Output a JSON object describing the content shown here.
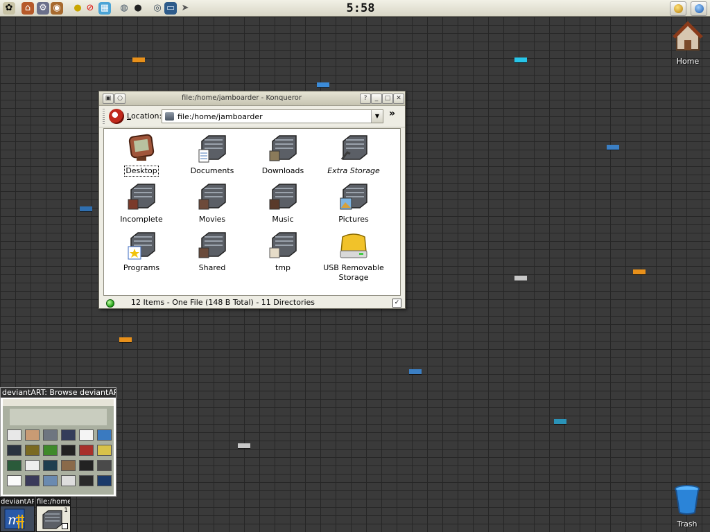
{
  "panel": {
    "clock": "5:58",
    "launchers": [
      "kde-menu-icon",
      "home-folder-icon",
      "settings-icon",
      "eye-icon",
      "bulb-icon",
      "stop-icon",
      "network-icon",
      "globe-icon",
      "ball-icon",
      "eye2-icon",
      "screen-icon",
      "paper-plane-icon"
    ],
    "right_buttons": [
      "lock-icon",
      "logout-icon"
    ]
  },
  "desktop": {
    "home_label": "Home",
    "trash_label": "Trash"
  },
  "konqueror": {
    "title": "file:/home/jamboarder - Konqueror",
    "location_label_pre": "L",
    "location_label_post": "ocation:",
    "location_value": "file:/home/jamboarder",
    "extra_button": "»",
    "items": [
      {
        "name": "Desktop",
        "icon": "desktop-icon",
        "selected": true
      },
      {
        "name": "Documents",
        "icon": "documents-folder-icon"
      },
      {
        "name": "Downloads",
        "icon": "downloads-folder-icon"
      },
      {
        "name": "Extra Storage",
        "icon": "extra-storage-folder-icon",
        "italic": true
      },
      {
        "name": "Incomplete",
        "icon": "incomplete-folder-icon"
      },
      {
        "name": "Movies",
        "icon": "movies-folder-icon"
      },
      {
        "name": "Music",
        "icon": "music-folder-icon"
      },
      {
        "name": "Pictures",
        "icon": "pictures-folder-icon"
      },
      {
        "name": "Programs",
        "icon": "programs-folder-icon"
      },
      {
        "name": "Shared",
        "icon": "shared-folder-icon"
      },
      {
        "name": "tmp",
        "icon": "tmp-folder-icon"
      },
      {
        "name": "USB Removable Storage",
        "icon": "usb-drive-icon"
      }
    ],
    "status": "12 Items - One File (148 B Total) - 11 Directories"
  },
  "preview": {
    "title": "deviantART: Browse deviantART"
  },
  "taskbar": {
    "tasks": [
      {
        "label": "deviantART",
        "icon": "browser-icon"
      },
      {
        "label": "file:/home",
        "icon": "folder-icon",
        "number": "1"
      }
    ]
  },
  "colors": {
    "desktop_bg": "#3a3a3a",
    "panel_bg": "#e5e3d5",
    "brick_orange": "#e8901a",
    "brick_blue": "#3b7fc4",
    "brick_cyan": "#27c5e8",
    "brick_gray": "#c8c8c8"
  }
}
